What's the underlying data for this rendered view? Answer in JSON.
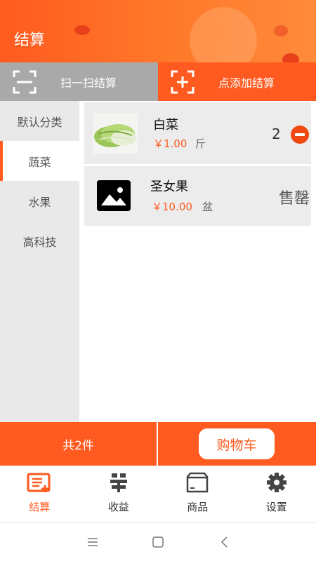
{
  "header": {
    "title": "结算"
  },
  "modes": {
    "scan_label": "扫一扫结算",
    "add_label": "点添加结算"
  },
  "categories": [
    {
      "label": "默认分类",
      "active": false
    },
    {
      "label": "蔬菜",
      "active": true
    },
    {
      "label": "水果",
      "active": false
    },
    {
      "label": "高科技",
      "active": false
    }
  ],
  "products": [
    {
      "name": "白菜",
      "price": "￥1.00",
      "unit": "斤",
      "quantity": "2",
      "thumb_icon": "napa-cabbage-image"
    },
    {
      "name": "圣女果",
      "price": "￥10.00",
      "unit": "盆",
      "status": "售罄",
      "thumb_icon": "image-placeholder-icon"
    }
  ],
  "cart": {
    "count_text": "共2件",
    "button_label": "购物车"
  },
  "tabs": [
    {
      "label": "结算",
      "icon": "checkout-icon",
      "active": true
    },
    {
      "label": "收益",
      "icon": "income-icon",
      "active": false
    },
    {
      "label": "商品",
      "icon": "product-box-icon",
      "active": false
    },
    {
      "label": "设置",
      "icon": "gear-icon",
      "active": false
    }
  ],
  "colors": {
    "accent": "#ff5a1f",
    "inactive_mode": "#a9a9a9",
    "sidebar_bg": "#e9e9e9",
    "card_bg": "#ececec"
  }
}
